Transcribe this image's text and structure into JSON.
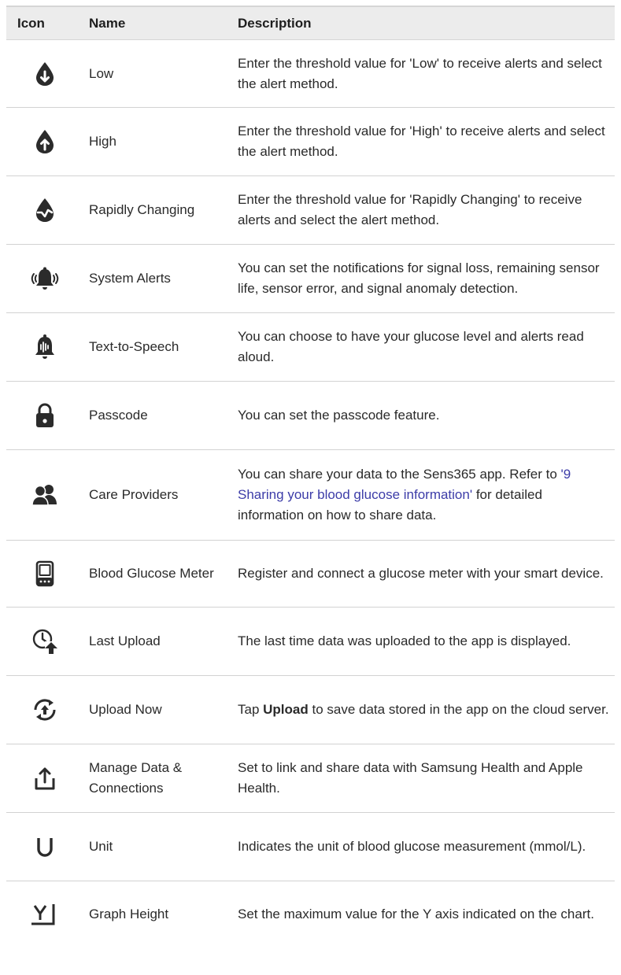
{
  "table": {
    "headers": {
      "icon": "Icon",
      "name": "Name",
      "description": "Description"
    },
    "rows": [
      {
        "icon": "drop-down-arrow-icon",
        "name": "Low",
        "description": "Enter the threshold value for 'Low' to receive alerts and select the alert method."
      },
      {
        "icon": "drop-up-arrow-icon",
        "name": "High",
        "description": "Enter the threshold value for 'High' to receive alerts and select the alert method."
      },
      {
        "icon": "drop-wave-icon",
        "name": "Rapidly Changing",
        "description": "Enter the threshold value for 'Rapidly Changing' to receive alerts and select the alert method."
      },
      {
        "icon": "ringing-bell-icon",
        "name": "System Alerts",
        "description": "You can set the notifications for signal loss, remaining sensor life, sensor error, and signal anomaly detection."
      },
      {
        "icon": "bell-speech-icon",
        "name": "Text-to-Speech",
        "description": "You can choose to have your glucose level and alerts read aloud."
      },
      {
        "icon": "lock-icon",
        "name": "Passcode",
        "description": "You can set the passcode feature."
      },
      {
        "icon": "people-icon",
        "name": "Care Providers",
        "description_pre": "You can share your data to the Sens365 app. Refer to ",
        "description_link": "'9 Sharing your blood glucose information'",
        "description_post": " for detailed information on how to share data."
      },
      {
        "icon": "glucose-meter-icon",
        "name": "Blood Glucose Meter",
        "description": "Register and connect a glucose meter with your smart device."
      },
      {
        "icon": "clock-upload-icon",
        "name": "Last Upload",
        "description": "The last time data was uploaded to the app is displayed."
      },
      {
        "icon": "sync-icon",
        "name": "Upload Now",
        "description_pre": "Tap ",
        "description_bold": "Upload",
        "description_post": " to save data stored in the app on the cloud server."
      },
      {
        "icon": "share-upload-icon",
        "name": "Manage Data & Connections",
        "description": "Set to link and share data with Samsung Health and Apple Health."
      },
      {
        "icon": "unit-u-icon",
        "name": "Unit",
        "description": "Indicates the unit of blood glucose measurement (mmol/L)."
      },
      {
        "icon": "graph-y-axis-icon",
        "name": "Graph Height",
        "description": "Set the maximum value for the Y axis indicated on the chart."
      }
    ]
  },
  "colors": {
    "header_bg": "#ececec",
    "text": "#2a2a2a",
    "link": "#3c3ca8",
    "icon": "#2b2b2b",
    "rule": "#d2d2d2"
  }
}
